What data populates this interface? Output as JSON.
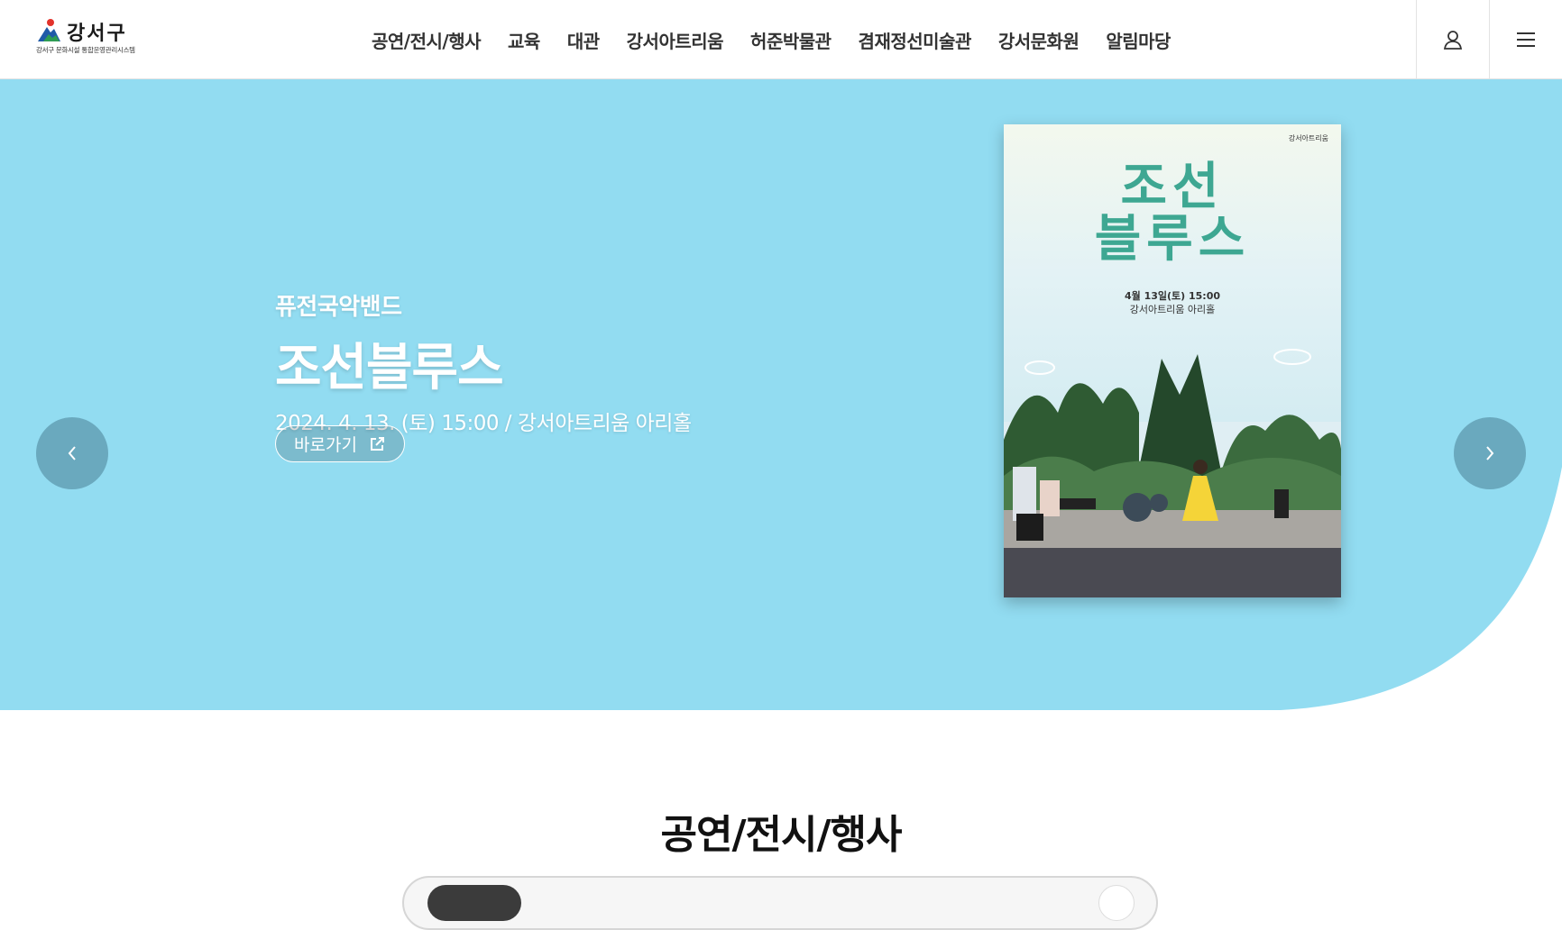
{
  "header": {
    "logo_title": "강서구",
    "logo_subtitle": "강서구 문화시설 통합운영관리시스템",
    "nav": [
      {
        "label": "공연/전시/행사"
      },
      {
        "label": "교육"
      },
      {
        "label": "대관"
      },
      {
        "label": "강서아트리움"
      },
      {
        "label": "허준박물관"
      },
      {
        "label": "겸재정선미술관"
      },
      {
        "label": "강서문화원"
      },
      {
        "label": "알림마당"
      }
    ],
    "icons": {
      "user": "user-icon",
      "menu": "hamburger-menu-icon"
    }
  },
  "hero": {
    "subtitle": "퓨전국악밴드",
    "title": "조선블루스",
    "info": "2024. 4. 13. (토) 15:00 / 강서아트리움 아리홀",
    "button_label": "바로가기",
    "bg_color": "#92dcf1",
    "arrow_color": "#6aa9be",
    "poster": {
      "brand": "강서아트리움",
      "title_line1": "조선",
      "title_line2": "블루스",
      "date": "4월 13일(토) 15:00",
      "venue": "강서아트리움 아리홀",
      "title_color": "#3ea792"
    }
  },
  "section": {
    "title": "공연/전시/행사"
  }
}
